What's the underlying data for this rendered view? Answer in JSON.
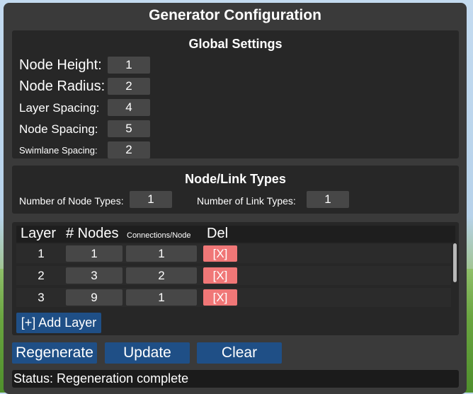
{
  "title": "Generator Configuration",
  "global": {
    "heading": "Global Settings",
    "fields": [
      {
        "label": "Node Height:",
        "value": "1"
      },
      {
        "label": "Node Radius:",
        "value": "2"
      },
      {
        "label": "Layer Spacing:",
        "value": "4"
      },
      {
        "label": "Node Spacing:",
        "value": "5"
      },
      {
        "label": "Swimlane Spacing:",
        "value": "2"
      }
    ]
  },
  "types": {
    "heading": "Node/Link Types",
    "node_label": "Number of Node Types:",
    "node_value": "1",
    "link_label": "Number of Link Types:",
    "link_value": "1"
  },
  "layers": {
    "headers": {
      "layer": "Layer",
      "nodes": "# Nodes",
      "connections": "Connections/Node",
      "del": "Del"
    },
    "rows": [
      {
        "layer": "1",
        "nodes": "1",
        "connections": "1",
        "del": "[X]"
      },
      {
        "layer": "2",
        "nodes": "3",
        "connections": "2",
        "del": "[X]"
      },
      {
        "layer": "3",
        "nodes": "9",
        "connections": "1",
        "del": "[X]"
      }
    ],
    "add_label": "[+] Add Layer"
  },
  "actions": {
    "regenerate": "Regenerate",
    "update": "Update",
    "clear": "Clear"
  },
  "status": "Status: Regeneration complete",
  "colors": {
    "panel": "#3a3a3a",
    "box": "#272727",
    "button": "#1f4f86",
    "delete": "#f07777"
  }
}
